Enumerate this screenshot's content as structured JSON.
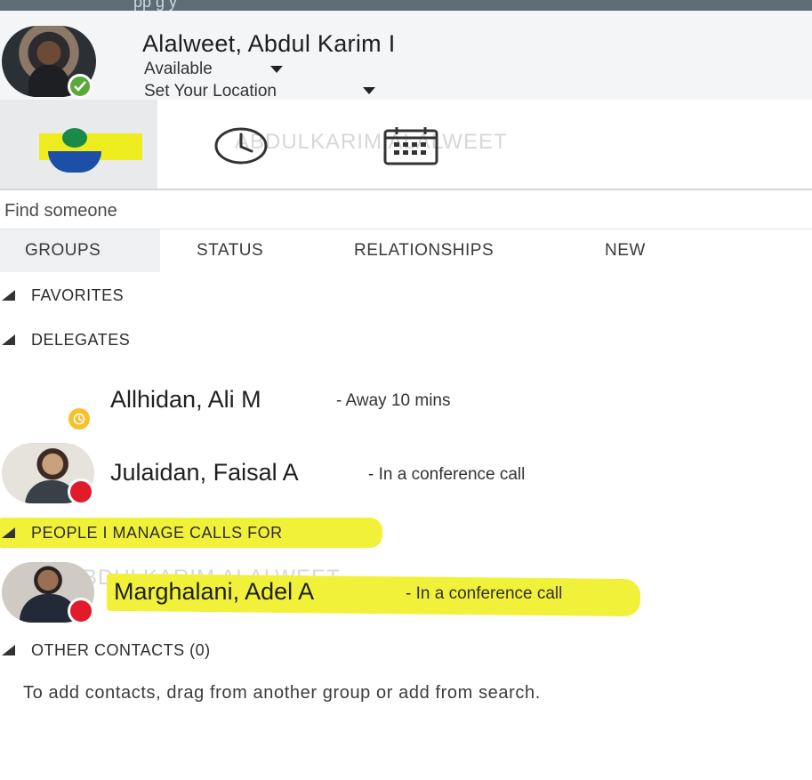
{
  "topbar": {
    "partial_text": "pp g y"
  },
  "me": {
    "name": "Alalweet, Abdul Karim I",
    "status": "Available",
    "location": "Set Your Location"
  },
  "toolbar": {
    "items": [
      {
        "id": "contacts",
        "icon": "contacts-icon",
        "selected": true
      },
      {
        "id": "recent",
        "icon": "clock-icon"
      },
      {
        "id": "meetings",
        "icon": "calendar-icon"
      }
    ],
    "watermark": "ABDULKARIM ALALWEET"
  },
  "search": {
    "placeholder": "Find someone"
  },
  "tabs": [
    {
      "label": "GROUPS",
      "active": true
    },
    {
      "label": "STATUS"
    },
    {
      "label": "RELATIONSHIPS"
    },
    {
      "label": "NEW"
    }
  ],
  "groups": {
    "favorites": {
      "label": "FAVORITES"
    },
    "delegates": {
      "label": "DELEGATES",
      "contacts": [
        {
          "name": "Allhidan, Ali M",
          "status": "- Away 10 mins",
          "presence": "away"
        },
        {
          "name": "Julaidan, Faisal A",
          "status": "- In a conference call",
          "presence": "busy"
        }
      ]
    },
    "manage_calls": {
      "label": "PEOPLE I MANAGE CALLS FOR",
      "contacts": [
        {
          "name": "Marghalani, Adel A",
          "status": "- In a conference call",
          "presence": "busy"
        }
      ]
    },
    "other": {
      "label": "OTHER CONTACTS (0)",
      "hint": "To add contacts, drag from another group or add from search."
    }
  },
  "colors": {
    "highlight": "#f1f13a",
    "available": "#5aa83a",
    "busy": "#e11b2a",
    "away": "#f6c12a",
    "contact_icon_green": "#1a8a49",
    "contact_icon_blue": "#1c4fa6"
  }
}
